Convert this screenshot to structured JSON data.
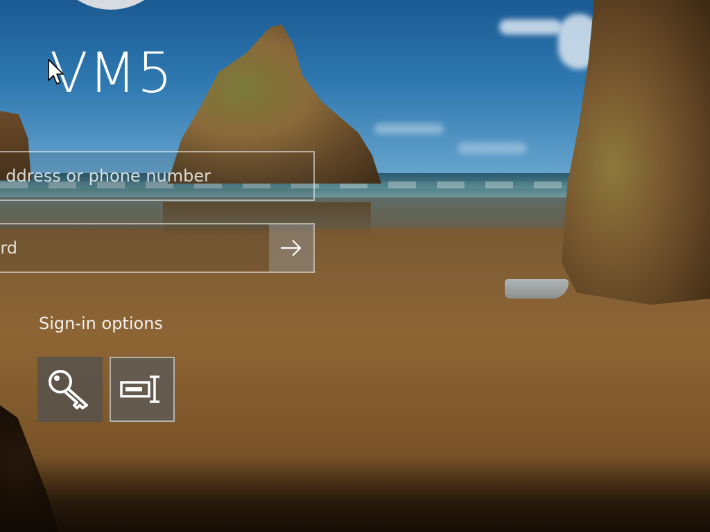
{
  "screen": {
    "user_name": "VM5"
  },
  "email_field": {
    "visible_text": "ddress or phone number",
    "icon": "none"
  },
  "password_field": {
    "visible_text": "rd",
    "submit_icon": "arrow-right-icon"
  },
  "sign_in_options": {
    "label": "Sign-in options",
    "options": [
      {
        "name": "password",
        "icon": "key-icon",
        "selected": false
      },
      {
        "name": "pin",
        "icon": "pin-keypad-icon",
        "selected": true
      }
    ]
  },
  "colors": {
    "text": "#ffffff",
    "field_border": "#d9d9d9",
    "option_bg": "#505050",
    "submit_bg": "#a0a0a0"
  }
}
